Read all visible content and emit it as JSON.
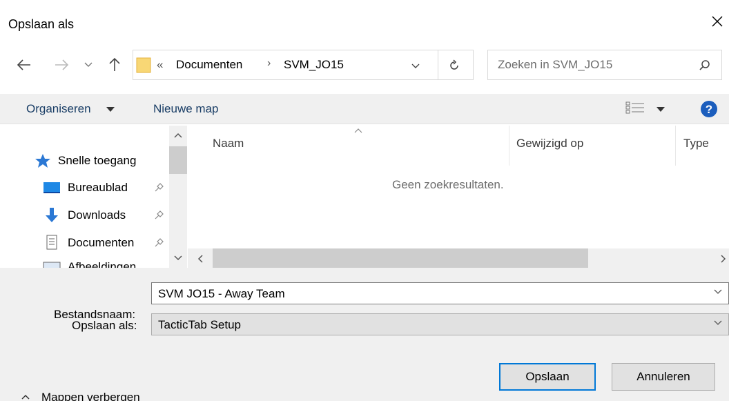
{
  "window": {
    "title": "Opslaan als",
    "close_icon": "close-icon"
  },
  "nav": {
    "breadcrumb_prefix": "«",
    "path": [
      "Documenten",
      "SVM_JO15"
    ],
    "search_placeholder": "Zoeken in SVM_JO15"
  },
  "toolbar": {
    "organize_label": "Organiseren",
    "new_folder_label": "Nieuwe map"
  },
  "sidebar": {
    "quick_access": "Snelle toegang",
    "items": [
      {
        "label": "Bureaublad",
        "icon": "desktop-icon"
      },
      {
        "label": "Downloads",
        "icon": "download-icon"
      },
      {
        "label": "Documenten",
        "icon": "document-icon"
      },
      {
        "label": "Afbeeldingen",
        "icon": "pictures-icon"
      }
    ]
  },
  "filelist": {
    "columns": [
      "Naam",
      "Gewijzigd op",
      "Type"
    ],
    "empty_message": "Geen zoekresultaten."
  },
  "form": {
    "filename_label": "Bestandsnaam:",
    "filename_value": "SVM JO15 - Away Team",
    "savetype_label": "Opslaan als:",
    "savetype_value": "TacticTab Setup"
  },
  "footer": {
    "toggle_label": "Mappen verbergen",
    "save_button": "Opslaan",
    "cancel_button": "Annuleren"
  },
  "colors": {
    "accent": "#0078d7",
    "toolbar_text": "#1a3e66",
    "help": "#1c5ebd",
    "folder": "#f8d775"
  }
}
